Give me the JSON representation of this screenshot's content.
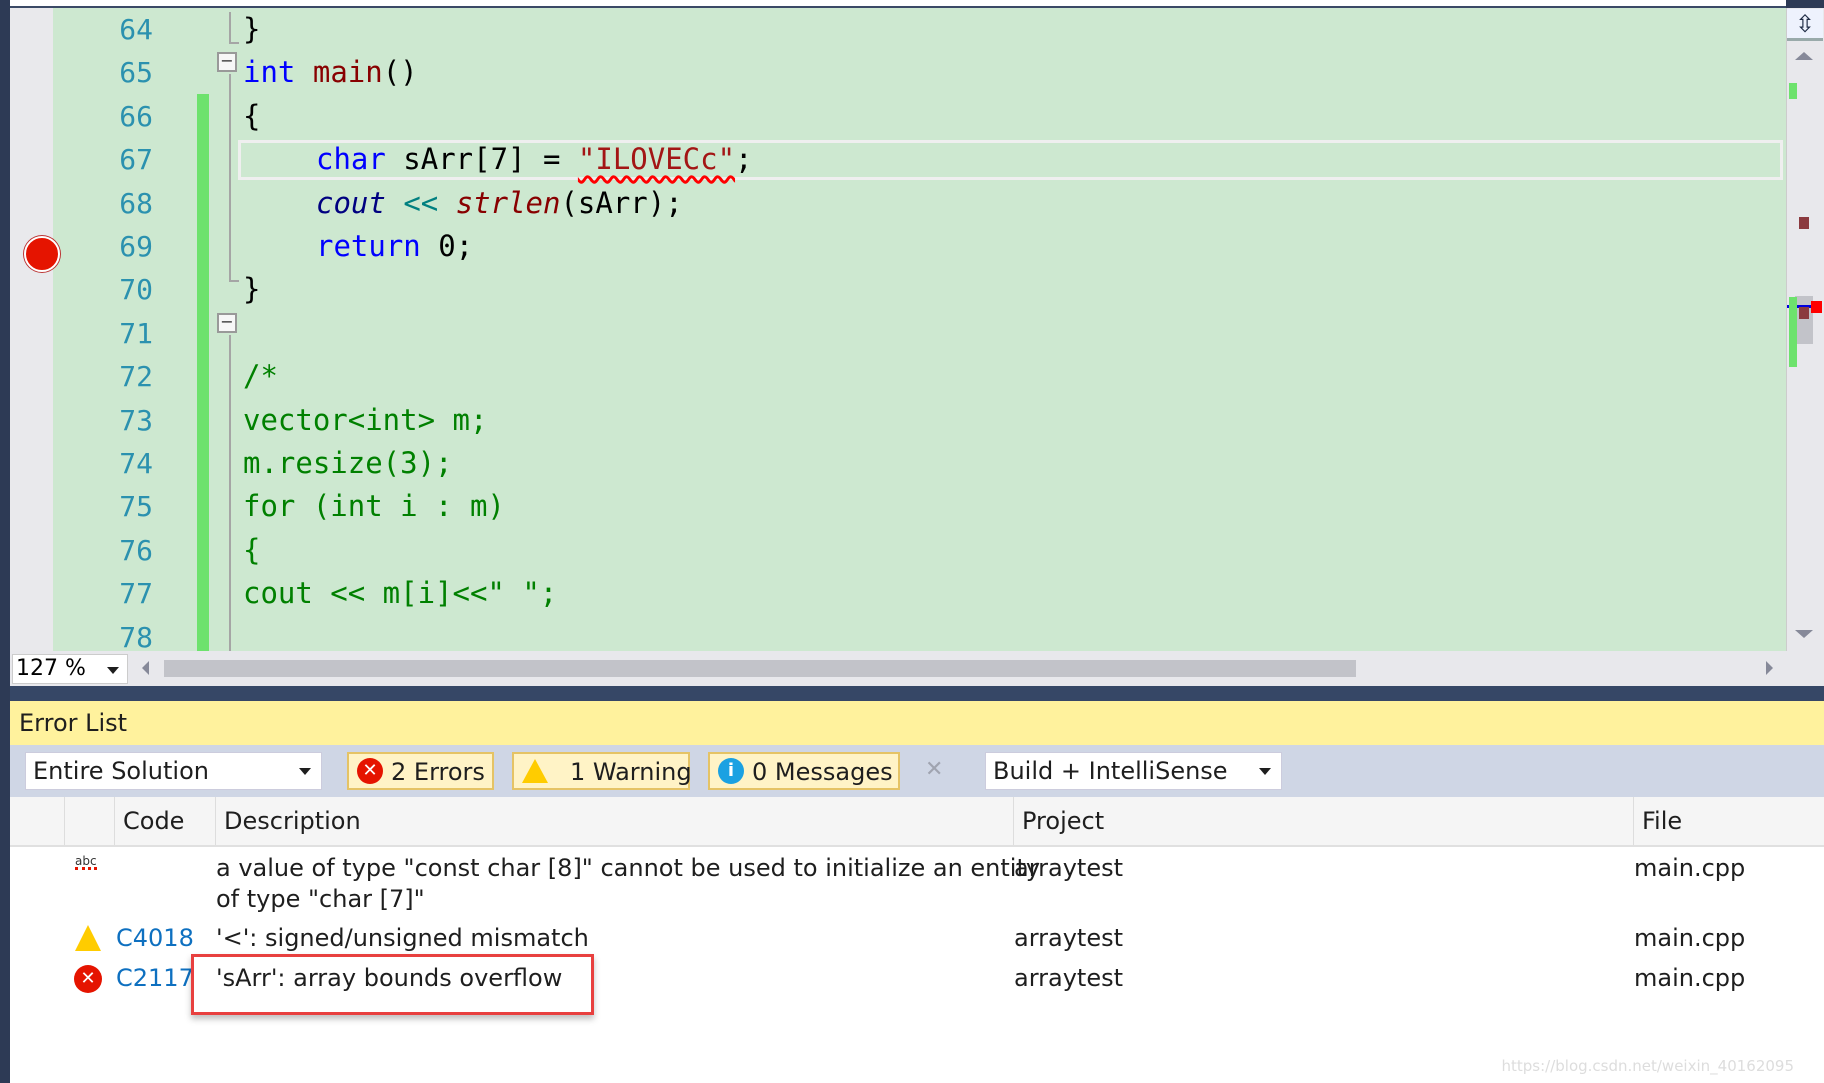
{
  "editor": {
    "lines": [
      {
        "n": "64",
        "tokens": [
          [
            "}",
            ""
          ]
        ],
        "indent": 0
      },
      {
        "n": "65",
        "tokens": [
          [
            "int",
            "kw"
          ],
          [
            " ",
            ""
          ],
          [
            "main",
            "fn"
          ],
          [
            "()",
            ""
          ]
        ],
        "indent": 0
      },
      {
        "n": "66",
        "tokens": [
          [
            "{",
            ""
          ]
        ],
        "indent": 0
      },
      {
        "n": "67",
        "tokens": [
          [
            "char",
            "kw"
          ],
          [
            " sArr[7] = ",
            ""
          ],
          [
            "\"ILOVECc\"",
            "str squig"
          ],
          [
            ";",
            ""
          ]
        ],
        "indent": 1
      },
      {
        "n": "68",
        "tokens": [
          [
            "cout",
            "nv it"
          ],
          [
            " ",
            ""
          ],
          [
            "<<",
            "op"
          ],
          [
            " ",
            ""
          ],
          [
            "strlen",
            "fn it"
          ],
          [
            "(sArr);",
            ""
          ]
        ],
        "indent": 1
      },
      {
        "n": "69",
        "tokens": [
          [
            "return",
            "kw"
          ],
          [
            " 0;",
            ""
          ]
        ],
        "indent": 1
      },
      {
        "n": "70",
        "tokens": [
          [
            "}",
            ""
          ]
        ],
        "indent": 0
      },
      {
        "n": "71",
        "tokens": [],
        "indent": 0
      },
      {
        "n": "72",
        "tokens": [
          [
            "/*",
            "cm"
          ]
        ],
        "indent": 0
      },
      {
        "n": "73",
        "tokens": [
          [
            "vector<int> m;",
            "cm"
          ]
        ],
        "indent": 0
      },
      {
        "n": "74",
        "tokens": [
          [
            "m.resize(3);",
            "cm"
          ]
        ],
        "indent": 0
      },
      {
        "n": "75",
        "tokens": [
          [
            "for (int i : m)",
            "cm"
          ]
        ],
        "indent": 0
      },
      {
        "n": "76",
        "tokens": [
          [
            "{",
            "cm"
          ]
        ],
        "indent": 0
      },
      {
        "n": "77",
        "tokens": [
          [
            "cout << m[i]<<\" \";",
            "cm"
          ]
        ],
        "indent": 0
      },
      {
        "n": "78",
        "tokens": [],
        "indent": 0
      }
    ],
    "breakpoint_line": "69",
    "current_line": "67",
    "zoom": "127 %"
  },
  "error_list": {
    "title": "Error List",
    "scope": "Entire Solution",
    "errors_label": "2 Errors",
    "warnings_label": "1 Warning",
    "messages_label": "0 Messages",
    "source": "Build + IntelliSense",
    "columns": {
      "code": "Code",
      "description": "Description",
      "project": "Project",
      "file": "File"
    },
    "rows": [
      {
        "icon": "intellisense-spell-icon",
        "code": "",
        "description": "a value of type \"const char [8]\" cannot be used to initialize an entity",
        "description2": "of type \"char [7]\"",
        "project": "arraytest",
        "file": "main.cpp"
      },
      {
        "icon": "warning-icon",
        "code": "C4018",
        "description": "'<': signed/unsigned mismatch",
        "project": "arraytest",
        "file": "main.cpp"
      },
      {
        "icon": "error-icon",
        "code": "C2117",
        "description": "'sArr': array bounds overflow",
        "project": "arraytest",
        "file": "main.cpp"
      }
    ]
  },
  "colors": {
    "editor_bg": "#cde8d0",
    "error_list_header": "#fff29d",
    "highlight_box": "#e8403f",
    "error": "#e51400",
    "warning": "#ffcc00",
    "info": "#1ba1e2"
  },
  "watermark": "https://blog.csdn.net/weixin_40162095"
}
